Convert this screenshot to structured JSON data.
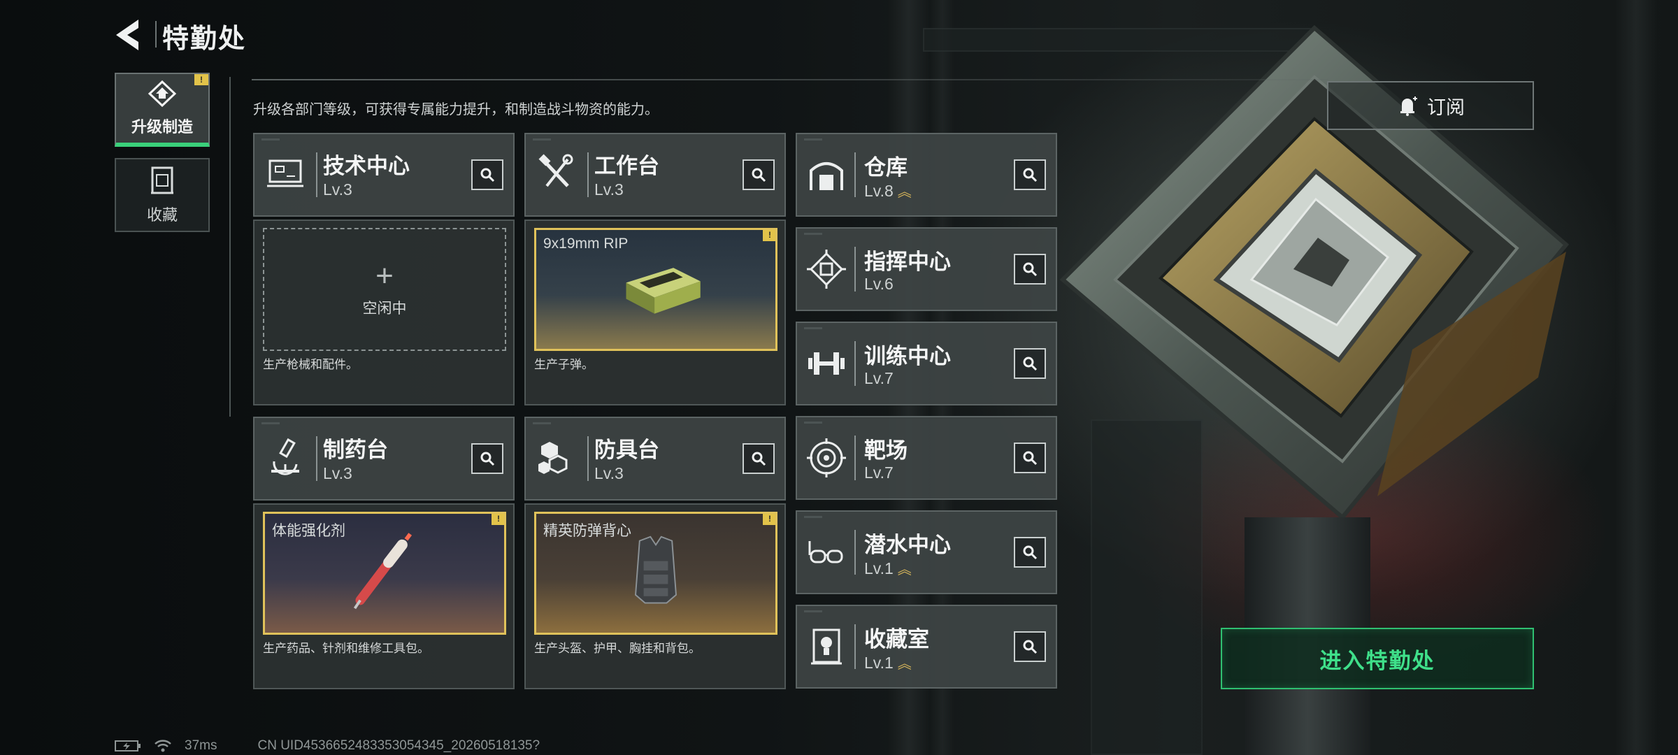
{
  "header": {
    "title": "特勤处"
  },
  "nav": [
    {
      "label": "升级制造",
      "icon": "upgrade-icon",
      "active": true,
      "alert": "!"
    },
    {
      "label": "收藏",
      "icon": "collection-icon",
      "active": false
    }
  ],
  "description": "升级各部门等级，可获得专属能力提升，和制造战斗物资的能力。",
  "production_cards": [
    {
      "name": "技术中心",
      "level": "Lv.3",
      "icon": "monitor-icon",
      "slot_type": "idle",
      "slot_text": "空闲中",
      "caption": "生产枪械和配件。"
    },
    {
      "name": "工作台",
      "level": "Lv.3",
      "icon": "tools-icon",
      "slot_type": "product",
      "product": "9x19mm RIP",
      "alert": "!",
      "caption": "生产子弹。"
    },
    {
      "name": "制药台",
      "level": "Lv.3",
      "icon": "microscope-icon",
      "slot_type": "product",
      "product": "体能强化剂",
      "alert": "!",
      "caption": "生产药品、针剂和维修工具包。"
    },
    {
      "name": "防具台",
      "level": "Lv.3",
      "icon": "armor-blocks-icon",
      "slot_type": "product",
      "product": "精英防弹背心",
      "alert": "!",
      "caption": "生产头盔、护甲、胸挂和背包。"
    }
  ],
  "facilities": [
    {
      "name": "仓库",
      "level": "Lv.8",
      "icon": "warehouse-icon",
      "upgrade": "︽"
    },
    {
      "name": "指挥中心",
      "level": "Lv.6",
      "icon": "chip-icon",
      "upgrade": ""
    },
    {
      "name": "训练中心",
      "level": "Lv.7",
      "icon": "dumbbell-icon",
      "upgrade": ""
    },
    {
      "name": "靶场",
      "level": "Lv.7",
      "icon": "target-icon",
      "upgrade": ""
    },
    {
      "name": "潜水中心",
      "level": "Lv.1",
      "icon": "diving-mask-icon",
      "upgrade": "︽"
    },
    {
      "name": "收藏室",
      "level": "Lv.1",
      "icon": "trophy-icon",
      "upgrade": "︽"
    }
  ],
  "subscribe_label": "订阅",
  "enter_label": "进入特勤处",
  "status": {
    "ping": "37ms",
    "uid": "CN UID4536652483353054345_20260518135?"
  },
  "colors": {
    "accent_green": "#3fe08a",
    "alert_yellow": "#e2c34a",
    "upgrade_gold": "#d7b55a"
  }
}
